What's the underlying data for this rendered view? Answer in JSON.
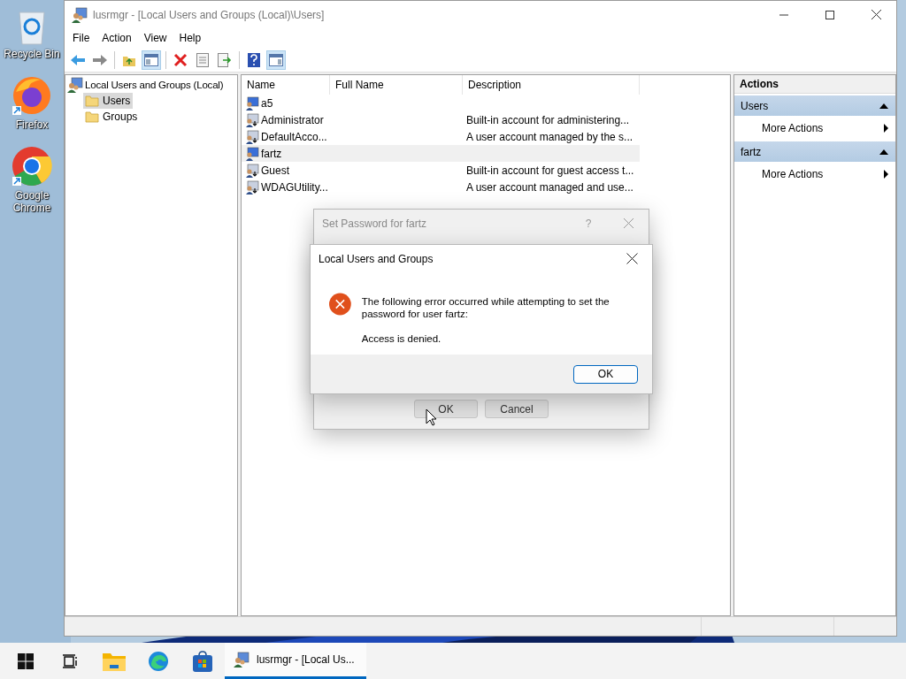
{
  "desktop_icons": [
    {
      "label": "Recycle Bin",
      "kind": "recycle"
    },
    {
      "label": "Firefox",
      "kind": "firefox"
    },
    {
      "label": "Google Chrome",
      "kind": "chrome"
    }
  ],
  "window": {
    "title": "lusrmgr - [Local Users and Groups (Local)\\Users]"
  },
  "menu": [
    "File",
    "Action",
    "View",
    "Help"
  ],
  "tree": {
    "label": "Local Users and Groups (Local)",
    "children": [
      {
        "label": "Users",
        "selected": true
      },
      {
        "label": "Groups",
        "selected": false
      }
    ]
  },
  "table": {
    "columns": [
      "Name",
      "Full Name",
      "Description"
    ],
    "rows": [
      {
        "name": "a5",
        "kind": "enabled",
        "selected": false
      },
      {
        "name": "Administrator",
        "kind": "disabled",
        "selected": false,
        "description": "Built-in account for administering..."
      },
      {
        "name": "DefaultAcco...",
        "kind": "disabled",
        "selected": false,
        "description": "A user account managed by the s..."
      },
      {
        "name": "fartz",
        "kind": "enabled",
        "selected": true
      },
      {
        "name": "Guest",
        "kind": "disabled",
        "selected": false,
        "description": "Built-in account for guest access t..."
      },
      {
        "name": "WDAGUtility...",
        "kind": "disabled",
        "selected": false,
        "description": "A user account managed and use..."
      }
    ]
  },
  "actions": {
    "title": "Actions",
    "sections": [
      {
        "title": "Users",
        "items": [
          "More Actions"
        ]
      },
      {
        "title": "fartz",
        "items": [
          "More Actions"
        ]
      }
    ]
  },
  "back_dialog": {
    "title": "Set Password for fartz",
    "help": "?",
    "buttons": [
      "OK",
      "Cancel"
    ]
  },
  "error_dialog": {
    "title": "Local Users and Groups",
    "message": "The following error occurred while attempting to set the password for user fartz:",
    "detail": "Access is denied.",
    "button": "OK"
  },
  "taskbar": {
    "items": [
      {
        "kind": "start"
      },
      {
        "kind": "task-view"
      },
      {
        "kind": "explorer"
      },
      {
        "kind": "edge"
      },
      {
        "kind": "store"
      },
      {
        "kind": "window",
        "label": "lusrmgr - [Local Us...",
        "selected": true
      }
    ]
  }
}
